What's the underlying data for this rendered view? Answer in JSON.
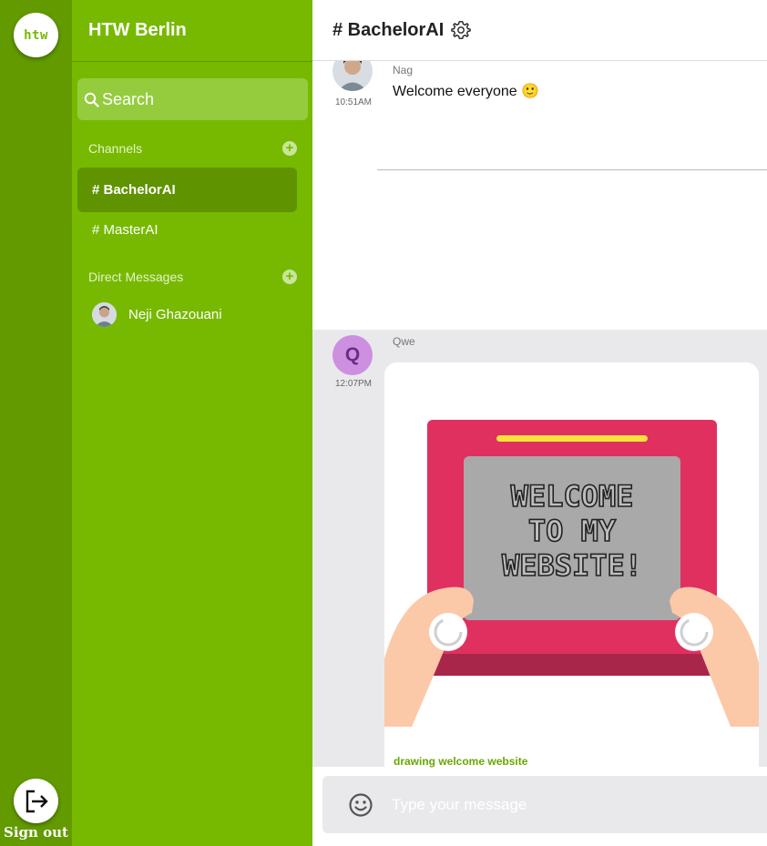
{
  "rail": {
    "logo_text": "htw",
    "signout_label": "Sign out"
  },
  "sidebar": {
    "workspace_name": "HTW Berlin",
    "search_placeholder": "Search",
    "channels_title": "Channels",
    "channels": [
      {
        "label": "# BachelorAI",
        "active": true
      },
      {
        "label": "# MasterAI",
        "active": false
      }
    ],
    "dm_title": "Direct Messages",
    "direct_messages": [
      {
        "name": "Neji Ghazouani"
      }
    ]
  },
  "header": {
    "channel_title": "# BachelorAI"
  },
  "messages": [
    {
      "author": "Nag",
      "time": "10:51AM",
      "text": "Welcome everyone 🙂"
    },
    {
      "author": "Qwe",
      "time": "12:07PM",
      "avatar_letter": "Q",
      "image_text": [
        "WELCOME",
        "TO MY",
        "WEBSITE!"
      ],
      "image_caption": "drawing welcome website"
    }
  ],
  "composer": {
    "placeholder": "Type your message"
  },
  "colors": {
    "rail": "#629a00",
    "sidebar": "#76b900",
    "active_channel": "#5f9300",
    "accent_link": "#6aa700"
  }
}
